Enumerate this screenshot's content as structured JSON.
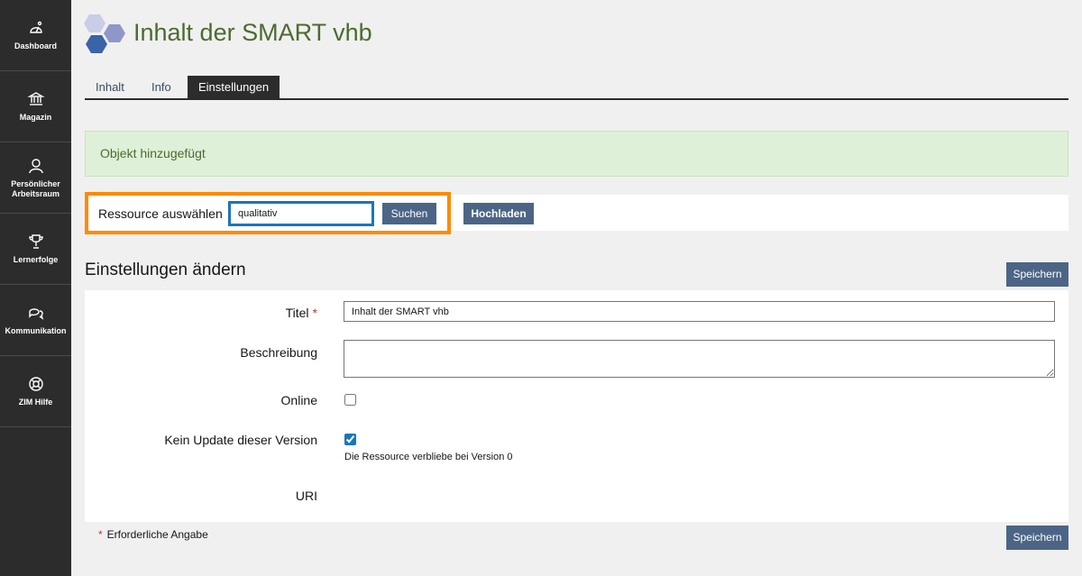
{
  "sidebar": {
    "items": [
      {
        "label": "Dashboard",
        "icon": "dashboard-icon"
      },
      {
        "label": "Magazin",
        "icon": "bank-icon"
      },
      {
        "label": "Persönlicher\nArbeitsraum",
        "icon": "person-icon"
      },
      {
        "label": "Lernerfolge",
        "icon": "trophy-icon"
      },
      {
        "label": "Kommunikation",
        "icon": "chat-icon"
      },
      {
        "label": "ZIM Hilfe",
        "icon": "lifebuoy-icon"
      }
    ]
  },
  "header": {
    "title": "Inhalt der SMART vhb",
    "logo_colors": [
      "#c9cde6",
      "#8f97c9",
      "#3a63a8"
    ]
  },
  "tabs": [
    {
      "label": "Inhalt",
      "active": false
    },
    {
      "label": "Info",
      "active": false
    },
    {
      "label": "Einstellungen",
      "active": true
    }
  ],
  "message": {
    "text": "Objekt hinzugefügt"
  },
  "resource": {
    "label": "Ressource auswählen",
    "input_value": "qualitativ",
    "search_button": "Suchen",
    "upload_button": "Hochladen"
  },
  "settings": {
    "title": "Einstellungen ändern",
    "save_button": "Speichern",
    "fields": {
      "title_label": "Titel",
      "title_value": "Inhalt der SMART vhb",
      "description_label": "Beschreibung",
      "online_label": "Online",
      "no_update_label": "Kein Update dieser Version",
      "no_update_help": "Die Ressource verbliebe bei Version 0",
      "uri_label": "URI"
    },
    "required_star": "*",
    "required_note": "Erforderliche Angabe"
  },
  "colors": {
    "sidebar_bg": "#2c2c2c",
    "title_green": "#4c6b2f",
    "button_blue": "#4c6586",
    "highlight_orange": "#ff8a00",
    "success_bg": "#dff0d8",
    "focus_blue": "#1b75bb"
  }
}
